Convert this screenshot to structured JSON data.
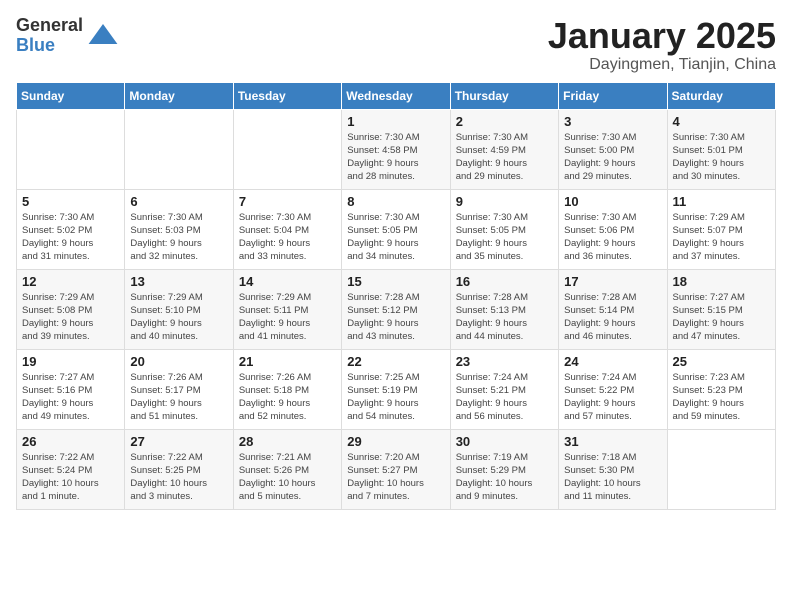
{
  "logo": {
    "general": "General",
    "blue": "Blue"
  },
  "header": {
    "month": "January 2025",
    "location": "Dayingmen, Tianjin, China"
  },
  "weekdays": [
    "Sunday",
    "Monday",
    "Tuesday",
    "Wednesday",
    "Thursday",
    "Friday",
    "Saturday"
  ],
  "weeks": [
    [
      {
        "day": "",
        "info": ""
      },
      {
        "day": "",
        "info": ""
      },
      {
        "day": "",
        "info": ""
      },
      {
        "day": "1",
        "info": "Sunrise: 7:30 AM\nSunset: 4:58 PM\nDaylight: 9 hours\nand 28 minutes."
      },
      {
        "day": "2",
        "info": "Sunrise: 7:30 AM\nSunset: 4:59 PM\nDaylight: 9 hours\nand 29 minutes."
      },
      {
        "day": "3",
        "info": "Sunrise: 7:30 AM\nSunset: 5:00 PM\nDaylight: 9 hours\nand 29 minutes."
      },
      {
        "day": "4",
        "info": "Sunrise: 7:30 AM\nSunset: 5:01 PM\nDaylight: 9 hours\nand 30 minutes."
      }
    ],
    [
      {
        "day": "5",
        "info": "Sunrise: 7:30 AM\nSunset: 5:02 PM\nDaylight: 9 hours\nand 31 minutes."
      },
      {
        "day": "6",
        "info": "Sunrise: 7:30 AM\nSunset: 5:03 PM\nDaylight: 9 hours\nand 32 minutes."
      },
      {
        "day": "7",
        "info": "Sunrise: 7:30 AM\nSunset: 5:04 PM\nDaylight: 9 hours\nand 33 minutes."
      },
      {
        "day": "8",
        "info": "Sunrise: 7:30 AM\nSunset: 5:05 PM\nDaylight: 9 hours\nand 34 minutes."
      },
      {
        "day": "9",
        "info": "Sunrise: 7:30 AM\nSunset: 5:05 PM\nDaylight: 9 hours\nand 35 minutes."
      },
      {
        "day": "10",
        "info": "Sunrise: 7:30 AM\nSunset: 5:06 PM\nDaylight: 9 hours\nand 36 minutes."
      },
      {
        "day": "11",
        "info": "Sunrise: 7:29 AM\nSunset: 5:07 PM\nDaylight: 9 hours\nand 37 minutes."
      }
    ],
    [
      {
        "day": "12",
        "info": "Sunrise: 7:29 AM\nSunset: 5:08 PM\nDaylight: 9 hours\nand 39 minutes."
      },
      {
        "day": "13",
        "info": "Sunrise: 7:29 AM\nSunset: 5:10 PM\nDaylight: 9 hours\nand 40 minutes."
      },
      {
        "day": "14",
        "info": "Sunrise: 7:29 AM\nSunset: 5:11 PM\nDaylight: 9 hours\nand 41 minutes."
      },
      {
        "day": "15",
        "info": "Sunrise: 7:28 AM\nSunset: 5:12 PM\nDaylight: 9 hours\nand 43 minutes."
      },
      {
        "day": "16",
        "info": "Sunrise: 7:28 AM\nSunset: 5:13 PM\nDaylight: 9 hours\nand 44 minutes."
      },
      {
        "day": "17",
        "info": "Sunrise: 7:28 AM\nSunset: 5:14 PM\nDaylight: 9 hours\nand 46 minutes."
      },
      {
        "day": "18",
        "info": "Sunrise: 7:27 AM\nSunset: 5:15 PM\nDaylight: 9 hours\nand 47 minutes."
      }
    ],
    [
      {
        "day": "19",
        "info": "Sunrise: 7:27 AM\nSunset: 5:16 PM\nDaylight: 9 hours\nand 49 minutes."
      },
      {
        "day": "20",
        "info": "Sunrise: 7:26 AM\nSunset: 5:17 PM\nDaylight: 9 hours\nand 51 minutes."
      },
      {
        "day": "21",
        "info": "Sunrise: 7:26 AM\nSunset: 5:18 PM\nDaylight: 9 hours\nand 52 minutes."
      },
      {
        "day": "22",
        "info": "Sunrise: 7:25 AM\nSunset: 5:19 PM\nDaylight: 9 hours\nand 54 minutes."
      },
      {
        "day": "23",
        "info": "Sunrise: 7:24 AM\nSunset: 5:21 PM\nDaylight: 9 hours\nand 56 minutes."
      },
      {
        "day": "24",
        "info": "Sunrise: 7:24 AM\nSunset: 5:22 PM\nDaylight: 9 hours\nand 57 minutes."
      },
      {
        "day": "25",
        "info": "Sunrise: 7:23 AM\nSunset: 5:23 PM\nDaylight: 9 hours\nand 59 minutes."
      }
    ],
    [
      {
        "day": "26",
        "info": "Sunrise: 7:22 AM\nSunset: 5:24 PM\nDaylight: 10 hours\nand 1 minute."
      },
      {
        "day": "27",
        "info": "Sunrise: 7:22 AM\nSunset: 5:25 PM\nDaylight: 10 hours\nand 3 minutes."
      },
      {
        "day": "28",
        "info": "Sunrise: 7:21 AM\nSunset: 5:26 PM\nDaylight: 10 hours\nand 5 minutes."
      },
      {
        "day": "29",
        "info": "Sunrise: 7:20 AM\nSunset: 5:27 PM\nDaylight: 10 hours\nand 7 minutes."
      },
      {
        "day": "30",
        "info": "Sunrise: 7:19 AM\nSunset: 5:29 PM\nDaylight: 10 hours\nand 9 minutes."
      },
      {
        "day": "31",
        "info": "Sunrise: 7:18 AM\nSunset: 5:30 PM\nDaylight: 10 hours\nand 11 minutes."
      },
      {
        "day": "",
        "info": ""
      }
    ]
  ]
}
